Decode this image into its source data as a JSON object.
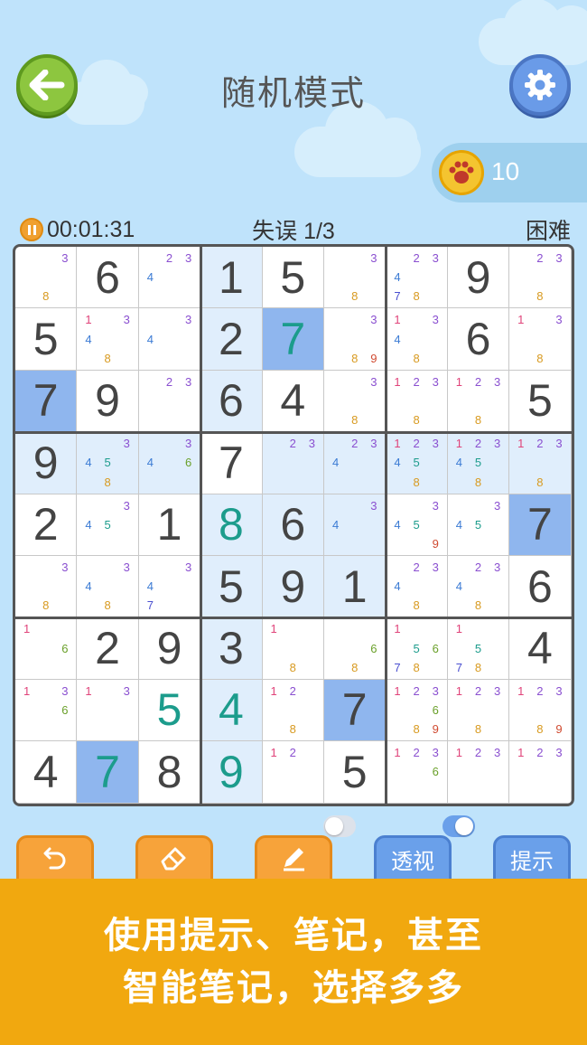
{
  "header": {
    "title": "随机模式"
  },
  "coins": {
    "count": "10"
  },
  "status": {
    "timer": "00:01:31",
    "mistakes": "失误 1/3",
    "difficulty": "困难"
  },
  "grid": [
    [
      {
        "n": "3,8"
      },
      {
        "v": 6
      },
      {
        "n": "2,3,4"
      },
      {
        "v": 1
      },
      {
        "v": 5
      },
      {
        "n": "3,8"
      },
      {
        "n": "2,3,4,7,8"
      },
      {
        "v": 9
      },
      {
        "n": "2,3,8"
      }
    ],
    [
      {
        "v": 5
      },
      {
        "n": "1,3,4,8"
      },
      {
        "n": "3,4"
      },
      {
        "v": 2
      },
      {
        "v": 7,
        "u": 1
      },
      {
        "n": "3,8,9"
      },
      {
        "n": "1,3,4,8"
      },
      {
        "v": 6
      },
      {
        "n": "1,3,8"
      }
    ],
    [
      {
        "v": 7
      },
      {
        "v": 9
      },
      {
        "n": "2,3"
      },
      {
        "v": 6
      },
      {
        "v": 4
      },
      {
        "n": "3,8"
      },
      {
        "n": "1,2,3,8"
      },
      {
        "n": "1,2,3,8"
      },
      {
        "v": 5
      }
    ],
    [
      {
        "v": 9
      },
      {
        "n": "3,4,5,8"
      },
      {
        "n": "3,4,6"
      },
      {
        "v": 7
      },
      {
        "n": "2,3"
      },
      {
        "n": "2,3,4"
      },
      {
        "n": "1,2,3,4,5,8"
      },
      {
        "n": "1,2,3,4,5,8"
      },
      {
        "n": "1,2,3,8"
      }
    ],
    [
      {
        "v": 2
      },
      {
        "n": "3,4,5"
      },
      {
        "v": 1
      },
      {
        "v": 8,
        "u": 1
      },
      {
        "v": 6
      },
      {
        "n": "3,4"
      },
      {
        "n": "3,4,5,9"
      },
      {
        "n": "3,4,5"
      },
      {
        "v": 7
      }
    ],
    [
      {
        "n": "3,8"
      },
      {
        "n": "3,4,8"
      },
      {
        "n": "3,4,7"
      },
      {
        "v": 5
      },
      {
        "v": 9
      },
      {
        "v": 1
      },
      {
        "n": "2,3,4,8"
      },
      {
        "n": "2,3,4,8"
      },
      {
        "v": 6
      }
    ],
    [
      {
        "n": "1,6"
      },
      {
        "v": 2
      },
      {
        "v": 9
      },
      {
        "v": 3
      },
      {
        "n": "1,8"
      },
      {
        "n": "6,8"
      },
      {
        "n": "1,5,6,7,8"
      },
      {
        "n": "1,5,7,8"
      },
      {
        "v": 4
      }
    ],
    [
      {
        "n": "1,3,6"
      },
      {
        "n": "1,3"
      },
      {
        "v": 5,
        "u": 1
      },
      {
        "v": 4,
        "u": 1
      },
      {
        "n": "1,2,8"
      },
      {
        "v": 7
      },
      {
        "n": "1,2,3,6,8,9"
      },
      {
        "n": "1,2,3,8"
      },
      {
        "n": "1,2,3,8,9"
      }
    ],
    [
      {
        "v": 4
      },
      {
        "v": 7,
        "u": 1
      },
      {
        "v": 8
      },
      {
        "v": 9,
        "u": 1
      },
      {
        "n": "1,2"
      },
      {
        "v": 5
      },
      {
        "n": "1,2,3,6"
      },
      {
        "n": "1,2,3"
      },
      {
        "n": "1,2,3"
      }
    ]
  ],
  "selected": {
    "row": 3,
    "col": 3
  },
  "toggles": {
    "left": "off",
    "right": "on"
  },
  "toolbar": {
    "undo_icon": "undo-icon",
    "erase_icon": "eraser-icon",
    "note_icon": "pencil-icon",
    "xray_label": "透视",
    "hint_label": "提示"
  },
  "promo": {
    "line1": "使用提示、笔记，甚至",
    "line2": "智能笔记，选择多多"
  },
  "colors": {
    "note_1": "#e0447a",
    "note_2": "#8a4fd0",
    "note_3": "#8a4fd0",
    "note_4": "#3b7bd4",
    "note_5": "#1c9c8c",
    "note_6": "#6aa02a",
    "note_7": "#4a4fd0",
    "note_8": "#d89a20",
    "note_9": "#d04a30",
    "user_digit": "#1c9c8c",
    "highlight": "#e0eefc",
    "same_digit": "#8fb6ee"
  }
}
